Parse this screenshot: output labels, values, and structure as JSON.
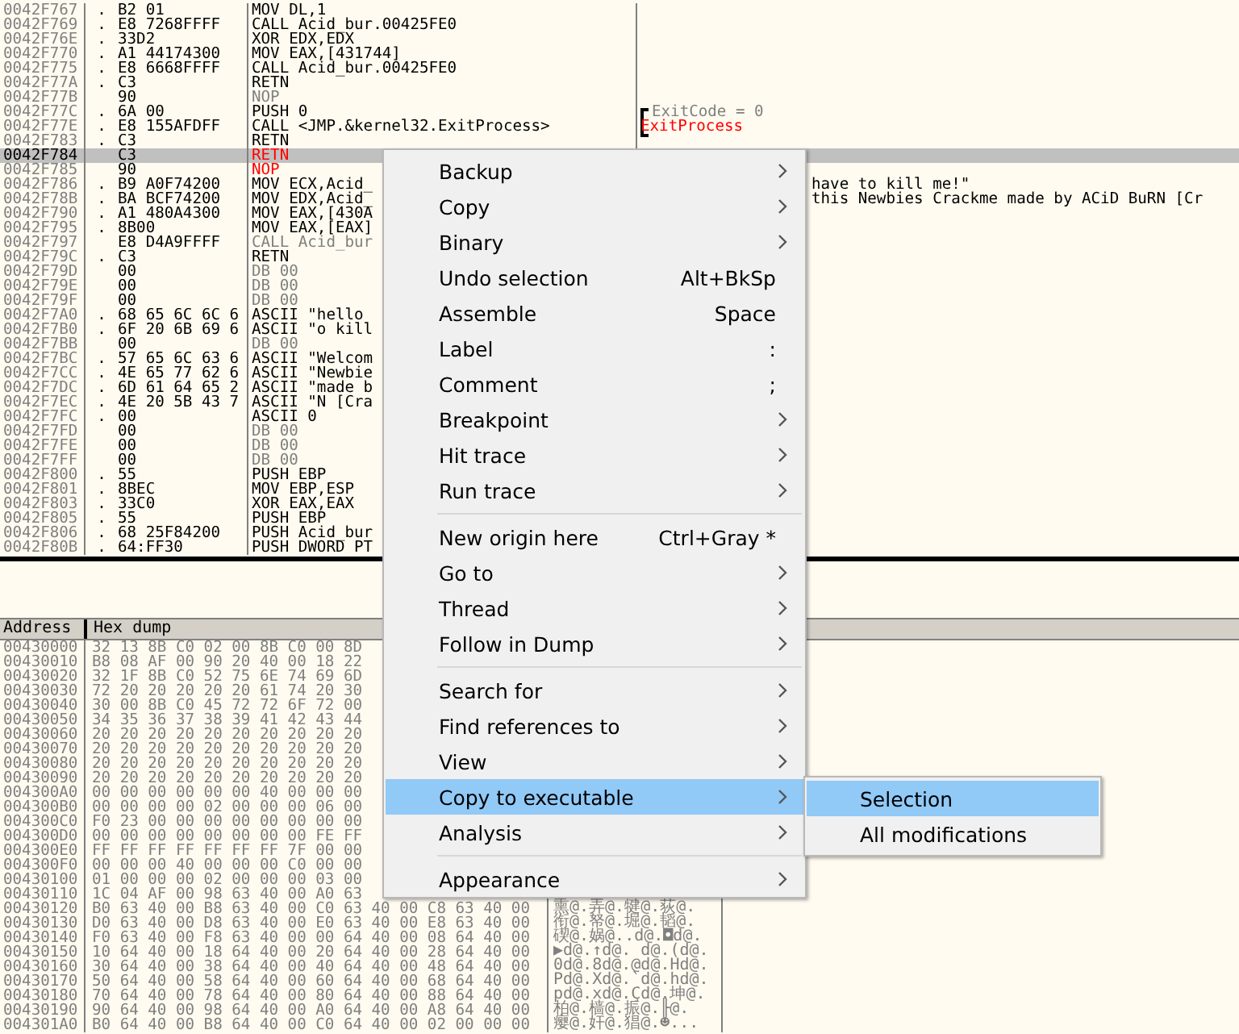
{
  "disassembly": {
    "rows": [
      {
        "address": "0042F767",
        "marker": ".",
        "hex": "B2 01",
        "command": "MOV DL,1",
        "kind": "code",
        "selected": false
      },
      {
        "address": "0042F769",
        "marker": ".",
        "hex": "E8 7268FFFF",
        "command": "CALL Acid_bur.00425FE0",
        "kind": "code",
        "selected": false
      },
      {
        "address": "0042F76E",
        "marker": ".",
        "hex": "33D2",
        "command": "XOR EDX,EDX",
        "kind": "code",
        "selected": false
      },
      {
        "address": "0042F770",
        "marker": ".",
        "hex": "A1 44174300",
        "command": "MOV EAX,[431744]",
        "kind": "code",
        "selected": false
      },
      {
        "address": "0042F775",
        "marker": ".",
        "hex": "E8 6668FFFF",
        "command": "CALL Acid_bur.00425FE0",
        "kind": "code",
        "selected": false
      },
      {
        "address": "0042F77A",
        "marker": ".",
        "hex": "C3",
        "command": "RETN",
        "kind": "code",
        "selected": false
      },
      {
        "address": "0042F77B",
        "hex": "90",
        "command": "NOP",
        "kind": "dim",
        "selected": false
      },
      {
        "address": "0042F77C",
        "marker": ".",
        "hex": "6A 00",
        "command": "PUSH 0",
        "kind": "code",
        "selected": false,
        "comment": {
          "text": "ExitCode = 0",
          "kind": "dim",
          "bracket": true
        }
      },
      {
        "address": "0042F77E",
        "marker": ".",
        "hex": "E8 155AFDFF",
        "command": "CALL <JMP.&kernel32.ExitProcess>",
        "kind": "code",
        "selected": false,
        "comment": {
          "text": "ExitProcess",
          "kind": "red"
        }
      },
      {
        "address": "0042F783",
        "marker": ".",
        "hex": "C3",
        "command": "RETN",
        "kind": "code",
        "selected": false
      },
      {
        "address": "0042F784",
        "hex": "C3",
        "command": "RETN",
        "kind": "red",
        "selected": true
      },
      {
        "address": "0042F785",
        "hex": "90",
        "command": "NOP",
        "kind": "red",
        "selected": false
      },
      {
        "address": "0042F786",
        "marker": ".",
        "hex": "B9 A0F74200",
        "command": "MOV ECX,Acid_",
        "kind": "code",
        "selected": false,
        "comment": {
          "text": "have to kill me!\"",
          "kind": "code",
          "covered": true
        }
      },
      {
        "address": "0042F78B",
        "marker": ".",
        "hex": "BA BCF74200",
        "command": "MOV EDX,Acid_",
        "kind": "code",
        "selected": false,
        "comment": {
          "text": "this Newbies Crackme made by ACiD BuRN [Cr",
          "kind": "code",
          "covered": true
        }
      },
      {
        "address": "0042F790",
        "marker": ".",
        "hex": "A1 480A4300",
        "command": "MOV EAX,[430A",
        "kind": "code",
        "selected": false
      },
      {
        "address": "0042F795",
        "marker": ".",
        "hex": "8B00",
        "command": "MOV EAX,[EAX]",
        "kind": "code",
        "selected": false
      },
      {
        "address": "0042F797",
        "hex": "E8 D4A9FFFF",
        "command": "CALL Acid_bur",
        "kind": "dim",
        "selected": false
      },
      {
        "address": "0042F79C",
        "marker": ".",
        "hex": "C3",
        "command": "RETN",
        "kind": "code",
        "selected": false
      },
      {
        "address": "0042F79D",
        "hex": "00",
        "command": "DB 00",
        "kind": "dim",
        "selected": false
      },
      {
        "address": "0042F79E",
        "hex": "00",
        "command": "DB 00",
        "kind": "dim",
        "selected": false
      },
      {
        "address": "0042F79F",
        "hex": "00",
        "command": "DB 00",
        "kind": "dim",
        "selected": false
      },
      {
        "address": "0042F7A0",
        "marker": ".",
        "hex": "68 65 6C 6C 6",
        "command": "ASCII \"hello",
        "kind": "code",
        "selected": false
      },
      {
        "address": "0042F7B0",
        "marker": ".",
        "hex": "6F 20 6B 69 6",
        "command": "ASCII \"o kill",
        "kind": "code",
        "selected": false
      },
      {
        "address": "0042F7BB",
        "hex": "00",
        "command": "DB 00",
        "kind": "dim",
        "selected": false
      },
      {
        "address": "0042F7BC",
        "marker": ".",
        "hex": "57 65 6C 63 6",
        "command": "ASCII \"Welcom",
        "kind": "code",
        "selected": false
      },
      {
        "address": "0042F7CC",
        "marker": ".",
        "hex": "4E 65 77 62 6",
        "command": "ASCII \"Newbie",
        "kind": "code",
        "selected": false
      },
      {
        "address": "0042F7DC",
        "marker": ".",
        "hex": "6D 61 64 65 2",
        "command": "ASCII \"made b",
        "kind": "code",
        "selected": false
      },
      {
        "address": "0042F7EC",
        "marker": ".",
        "hex": "4E 20 5B 43 7",
        "command": "ASCII \"N [Cra",
        "kind": "code",
        "selected": false
      },
      {
        "address": "0042F7FC",
        "marker": ".",
        "hex": "00",
        "command": "ASCII 0",
        "kind": "code",
        "selected": false
      },
      {
        "address": "0042F7FD",
        "hex": "00",
        "command": "DB 00",
        "kind": "dim",
        "selected": false
      },
      {
        "address": "0042F7FE",
        "hex": "00",
        "command": "DB 00",
        "kind": "dim",
        "selected": false
      },
      {
        "address": "0042F7FF",
        "hex": "00",
        "command": "DB 00",
        "kind": "dim",
        "selected": false
      },
      {
        "address": "0042F800",
        "marker": ".",
        "hex": "55",
        "command": "PUSH EBP",
        "kind": "code",
        "selected": false
      },
      {
        "address": "0042F801",
        "marker": ".",
        "hex": "8BEC",
        "command": "MOV EBP,ESP",
        "kind": "code",
        "selected": false
      },
      {
        "address": "0042F803",
        "marker": ".",
        "hex": "33C0",
        "command": "XOR EAX,EAX",
        "kind": "code",
        "selected": false
      },
      {
        "address": "0042F805",
        "marker": ".",
        "hex": "55",
        "command": "PUSH EBP",
        "kind": "code",
        "selected": false
      },
      {
        "address": "0042F806",
        "marker": ".",
        "hex": "68 25F84200",
        "command": "PUSH Acid_bur",
        "kind": "code",
        "selected": false
      },
      {
        "address": "0042F80B",
        "marker": ".",
        "hex": "64:FF30",
        "command": "PUSH DWORD PT",
        "kind": "code",
        "selected": false
      }
    ]
  },
  "dump": {
    "columns": [
      "Address",
      "Hex dump"
    ],
    "rows": [
      {
        "address": "00430000",
        "hex": "32 13 8B C0 02 00 8B C0 00 8D"
      },
      {
        "address": "00430010",
        "hex": "B8 08 AF 00 90 20 40 00 18 22"
      },
      {
        "address": "00430020",
        "hex": "32 1F 8B C0 52 75 6E 74 69 6D"
      },
      {
        "address": "00430030",
        "hex": "72 20 20 20 20 20 61 74 20 30"
      },
      {
        "address": "00430040",
        "hex": "30 00 8B C0 45 72 72 6F 72 00"
      },
      {
        "address": "00430050",
        "hex": "34 35 36 37 38 39 41 42 43 44"
      },
      {
        "address": "00430060",
        "hex": "20 20 20 20 20 20 20 20 20 20"
      },
      {
        "address": "00430070",
        "hex": "20 20 20 20 20 20 20 20 20 20"
      },
      {
        "address": "00430080",
        "hex": "20 20 20 20 20 20 20 20 20 20"
      },
      {
        "address": "00430090",
        "hex": "20 20 20 20 20 20 20 20 20 20"
      },
      {
        "address": "004300A0",
        "hex": "00 00 00 00 00 00 40 00 00 00"
      },
      {
        "address": "004300B0",
        "hex": "00 00 00 00 02 00 00 00 06 00"
      },
      {
        "address": "004300C0",
        "hex": "F0 23 00 00 00 00 00 00 00 00"
      },
      {
        "address": "004300D0",
        "hex": "00 00 00 00 00 00 00 00 FE FF"
      },
      {
        "address": "004300E0",
        "hex": "FF FF FF FF FF FF FF 7F 00 00"
      },
      {
        "address": "004300F0",
        "hex": "00 00 00 40 00 00 00 C0 00 00"
      },
      {
        "address": "00430100",
        "hex": "01 00 00 00 02 00 00 00 03 00"
      },
      {
        "address": "00430110",
        "hex": "1C 04 AF 00 98 63 40 00 A0 63"
      },
      {
        "address": "00430120",
        "hex": "B0 63 40 00 B8 63 40 00 C0 63 40 00 C8 63 40 00",
        "ascii": "熏@.弄@.犍@.荻@."
      },
      {
        "address": "00430130",
        "hex": "D0 63 40 00 D8 63 40 00 E0 63 40 00 E8 63 40 00",
        "ascii": "衔@.帑@.堀@.韬@."
      },
      {
        "address": "00430140",
        "hex": "F0 63 40 00 F8 63 40 00 00 64 40 00 08 64 40 00",
        "ascii": "碶@.娲@..d@.◘d@."
      },
      {
        "address": "00430150",
        "hex": "10 64 40 00 18 64 40 00 20 64 40 00 28 64 40 00",
        "ascii": "▶d@.↑d@. d@.(d@."
      },
      {
        "address": "00430160",
        "hex": "30 64 40 00 38 64 40 00 40 64 40 00 48 64 40 00",
        "ascii": "0d@.8d@.@d@.Hd@."
      },
      {
        "address": "00430170",
        "hex": "50 64 40 00 58 64 40 00 60 64 40 00 68 64 40 00",
        "ascii": "Pd@.Xd@.`d@.hd@."
      },
      {
        "address": "00430180",
        "hex": "70 64 40 00 78 64 40 00 80 64 40 00 88 64 40 00",
        "ascii": "pd@.xd@.Çd@.坤@."
      },
      {
        "address": "00430190",
        "hex": "90 64 40 00 98 64 40 00 A0 64 40 00 A8 64 40 00",
        "ascii": "柏@.樯@.振@.╟@."
      },
      {
        "address": "004301A0",
        "hex": "B0 64 40 00 B8 64 40 00 C0 64 40 00 02 00 00 00",
        "ascii": "瘿@.奸@.猖@.☻..."
      }
    ]
  },
  "context_menu": {
    "items": [
      {
        "kind": "item",
        "label": "Backup",
        "submenu": true,
        "selected": false
      },
      {
        "kind": "item",
        "label": "Copy",
        "submenu": true,
        "selected": false
      },
      {
        "kind": "item",
        "label": "Binary",
        "submenu": true,
        "selected": false
      },
      {
        "kind": "item",
        "label": "Undo selection",
        "shortcut": "Alt+BkSp",
        "selected": false
      },
      {
        "kind": "item",
        "label": "Assemble",
        "shortcut": "Space",
        "selected": false
      },
      {
        "kind": "item",
        "label": "Label",
        "shortcut": ":",
        "selected": false
      },
      {
        "kind": "item",
        "label": "Comment",
        "shortcut": ";",
        "selected": false
      },
      {
        "kind": "item",
        "label": "Breakpoint",
        "submenu": true,
        "selected": false
      },
      {
        "kind": "item",
        "label": "Hit trace",
        "submenu": true,
        "selected": false
      },
      {
        "kind": "item",
        "label": "Run trace",
        "submenu": true,
        "selected": false
      },
      {
        "kind": "separator"
      },
      {
        "kind": "item",
        "label": "New origin here",
        "shortcut": "Ctrl+Gray *",
        "selected": false
      },
      {
        "kind": "item",
        "label": "Go to",
        "submenu": true,
        "selected": false
      },
      {
        "kind": "item",
        "label": "Thread",
        "submenu": true,
        "selected": false
      },
      {
        "kind": "item",
        "label": "Follow in Dump",
        "submenu": true,
        "selected": false
      },
      {
        "kind": "separator"
      },
      {
        "kind": "item",
        "label": "Search for",
        "submenu": true,
        "selected": false
      },
      {
        "kind": "item",
        "label": "Find references to",
        "submenu": true,
        "selected": false
      },
      {
        "kind": "item",
        "label": "View",
        "submenu": true,
        "selected": false
      },
      {
        "kind": "item",
        "label": "Copy to executable",
        "submenu": true,
        "selected": true
      },
      {
        "kind": "item",
        "label": "Analysis",
        "submenu": true,
        "selected": false
      },
      {
        "kind": "separator"
      },
      {
        "kind": "item",
        "label": "Appearance",
        "submenu": true,
        "selected": false
      }
    ],
    "submenu": {
      "items": [
        {
          "kind": "item",
          "label": "Selection",
          "selected": true
        },
        {
          "kind": "item",
          "label": "All modifications",
          "selected": false
        }
      ]
    }
  }
}
